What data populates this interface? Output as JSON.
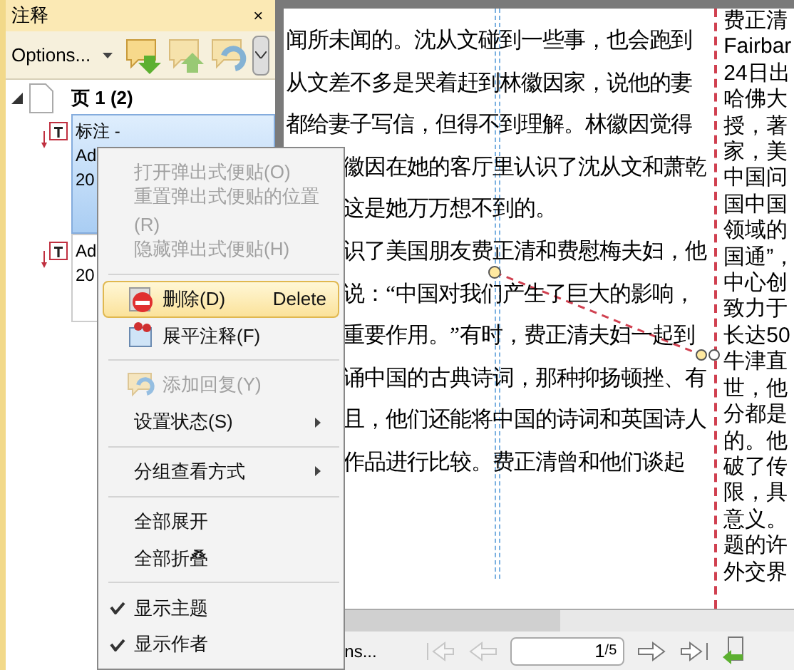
{
  "panel": {
    "title": "注释",
    "close": "×",
    "options_label": "Options...",
    "tree": {
      "label": "页 1 (2)",
      "expanded": true,
      "children": [
        {
          "title": "标注 -",
          "lines": [
            "Ad",
            "20"
          ],
          "selected": true
        },
        {
          "lines": [
            "Ad",
            "20"
          ],
          "selected": false
        }
      ]
    }
  },
  "document": {
    "left_lines": [
      "闻所未闻的。沈从文碰到一些事，也会跑到",
      "从文差不多是哭着赶到林徽因家，说他的妻",
      "都给妻子写信，但得不到理解。林徽因觉得",
      "徽因在她的客厅里认识了沈从文和萧乾",
      "这是她万万想不到的。",
      "识了美国朋友费正清和费慰梅夫妇，他",
      "说：“中国对我们产生了巨大的影响，",
      "重要作用。”有时，费正清夫妇一起到",
      "诵中国的古典诗词，那种抑扬顿挫、有",
      "且，他们还能将中国的诗词和英国诗人",
      "作品进行比较。费正清曾和他们谈起"
    ],
    "right_lines": [
      "费正清",
      "Fairbar",
      "24日出",
      "哈佛大",
      "授，著",
      "家，美",
      "中国问",
      "国中国",
      "领域的",
      "国通”，",
      "中心创",
      "致力于",
      "长达50",
      "牛津直",
      "世，他",
      "分都是",
      "的。他",
      "破了传",
      "限，具",
      "意义。",
      "题的许",
      "外交界"
    ]
  },
  "context_menu": [
    {
      "kind": "item",
      "label": "打开弹出式便贴(O)",
      "disabled": true,
      "selected": false
    },
    {
      "kind": "item",
      "label": "重置弹出式便贴的位置(R)",
      "disabled": true,
      "selected": false
    },
    {
      "kind": "item",
      "label": "隐藏弹出式便贴(H)",
      "disabled": true,
      "selected": false
    },
    {
      "kind": "separator"
    },
    {
      "kind": "item",
      "label": "删除(D)",
      "shortcut": "Delete",
      "disabled": false,
      "selected": true
    },
    {
      "kind": "item",
      "label": "展平注释(F)",
      "disabled": false,
      "selected": false
    },
    {
      "kind": "separator"
    },
    {
      "kind": "item",
      "label": "添加回复(Y)",
      "disabled": true,
      "selected": false
    },
    {
      "kind": "item",
      "label": "设置状态(S)",
      "submenu": true,
      "disabled": false,
      "selected": false
    },
    {
      "kind": "separator"
    },
    {
      "kind": "item",
      "label": "分组查看方式",
      "submenu": true,
      "disabled": false,
      "selected": false
    },
    {
      "kind": "separator"
    },
    {
      "kind": "item",
      "label": "全部展开",
      "disabled": false,
      "selected": false
    },
    {
      "kind": "item",
      "label": "全部折叠",
      "disabled": false,
      "selected": false
    },
    {
      "kind": "separator"
    },
    {
      "kind": "item",
      "label": "显示主题",
      "checked": true,
      "disabled": false,
      "selected": false
    },
    {
      "kind": "item",
      "label": "显示作者",
      "checked": true,
      "disabled": false,
      "selected": false
    }
  ],
  "bottom_bar": {
    "zoom_label": "ns...",
    "page": "1",
    "page_total": "/5"
  }
}
